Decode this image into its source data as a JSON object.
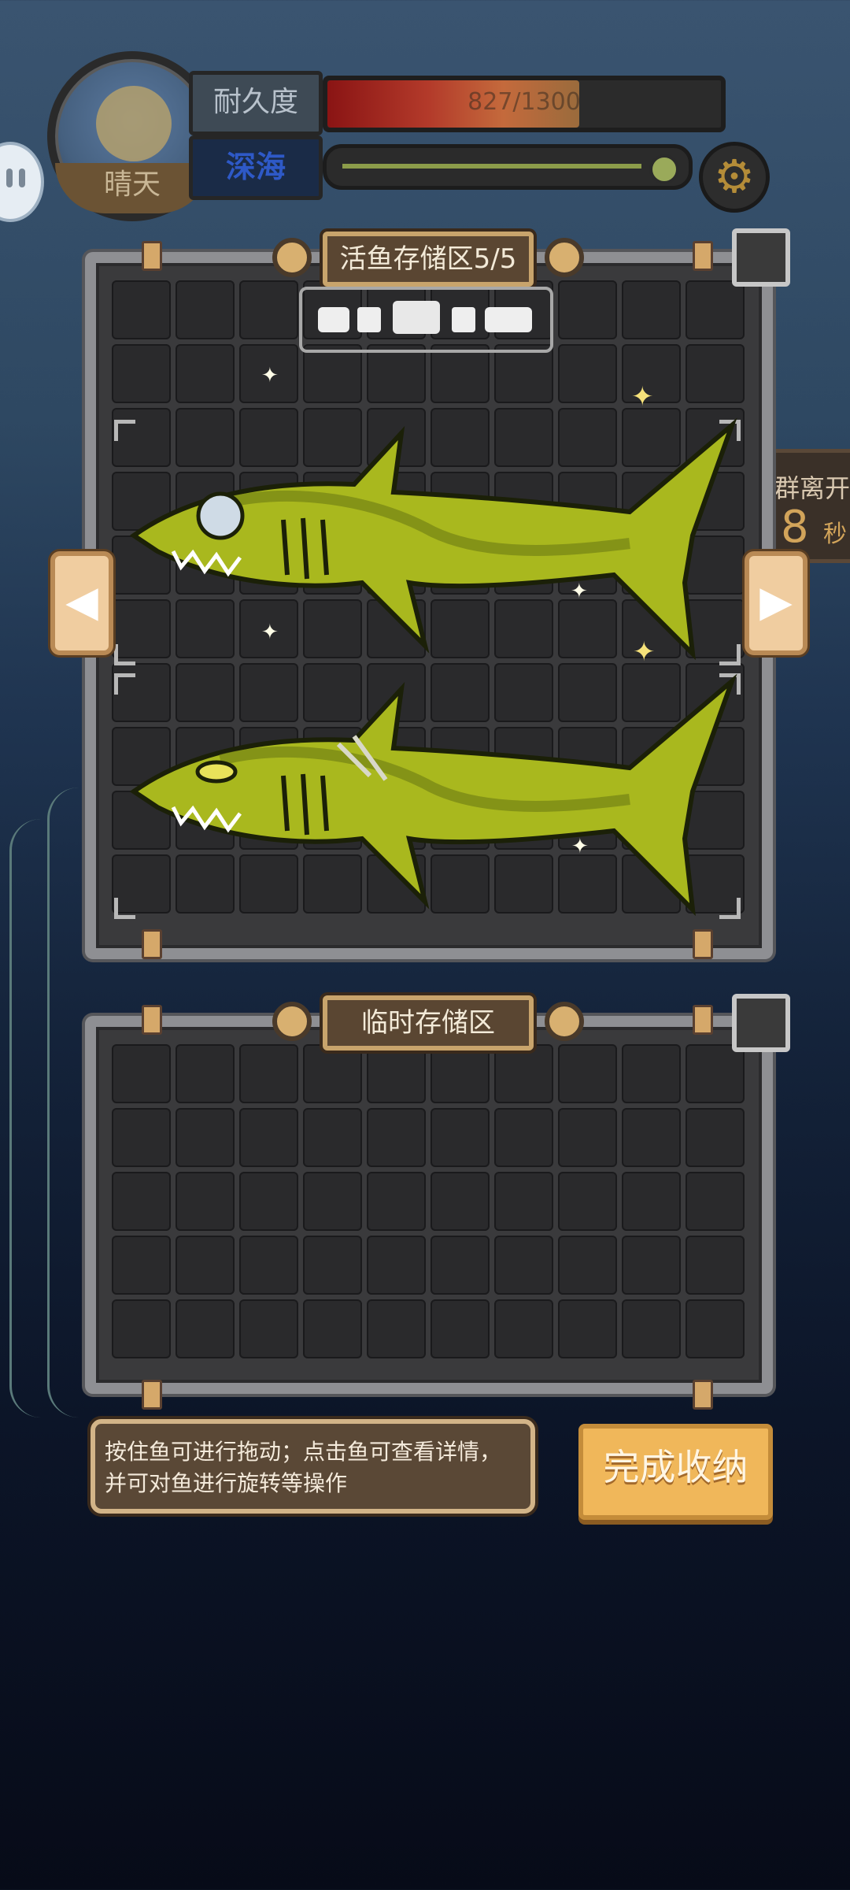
{
  "hud": {
    "weather": "晴天",
    "durability_label": "耐久度",
    "durability_value": "827/1300",
    "durability_fraction": 0.64,
    "depth_label": "深海",
    "settings_icon": "gear-icon"
  },
  "timer": {
    "text": "群离开",
    "number": "8",
    "unit": "秒"
  },
  "live_storage": {
    "title": "活鱼存储区5/5",
    "rows": 10,
    "cols": 10,
    "fish": [
      {
        "name": "shark-1",
        "color": "#a9b81e",
        "variant": "dead-eye"
      },
      {
        "name": "shark-2",
        "color": "#a9b81e",
        "variant": "scarred"
      }
    ]
  },
  "temp_storage": {
    "title": "临时存储区",
    "rows": 5,
    "cols": 10
  },
  "hint": {
    "text": "按住鱼可进行拖动；点击鱼可查看详情，并可对鱼进行旋转等操作"
  },
  "finish_button": {
    "label": "完成收纳"
  },
  "nav": {
    "prev_icon": "chevron-left-icon",
    "next_icon": "chevron-right-icon"
  }
}
